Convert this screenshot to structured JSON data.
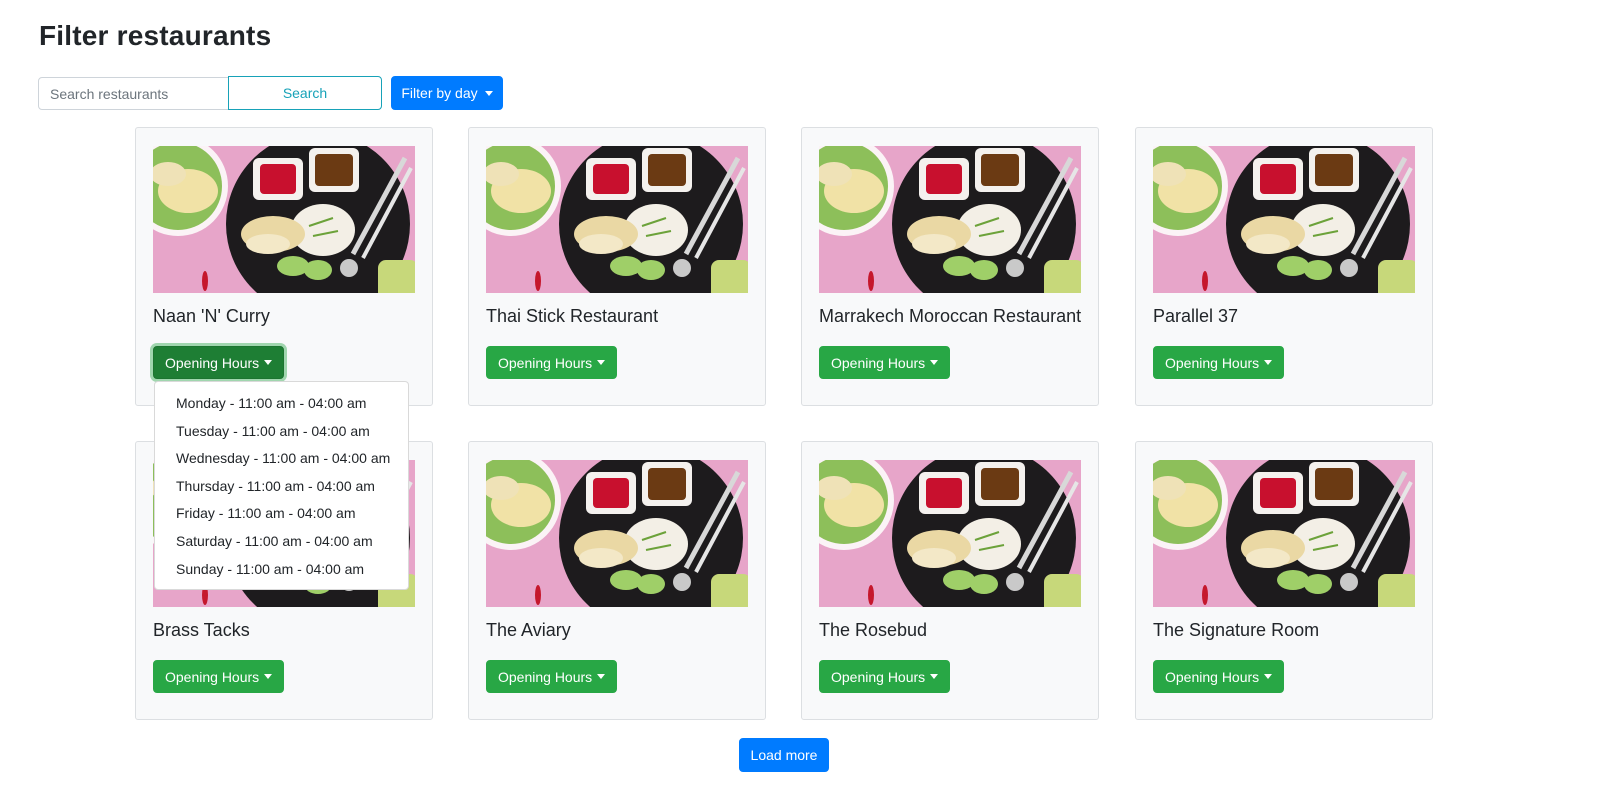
{
  "page": {
    "title": "Filter restaurants"
  },
  "search": {
    "placeholder": "Search restaurants",
    "value": "",
    "button_label": "Search"
  },
  "filter": {
    "button_label": "Filter by day"
  },
  "restaurants": [
    {
      "name": "Naan 'N' Curry",
      "hours_label": "Opening Hours"
    },
    {
      "name": "Thai Stick Restaurant",
      "hours_label": "Opening Hours"
    },
    {
      "name": "Marrakech Moroccan Restaurant",
      "hours_label": "Opening Hours"
    },
    {
      "name": "Parallel 37",
      "hours_label": "Opening Hours"
    },
    {
      "name": "Brass Tacks",
      "hours_label": "Opening Hours"
    },
    {
      "name": "The Aviary",
      "hours_label": "Opening Hours"
    },
    {
      "name": "The Rosebud",
      "hours_label": "Opening Hours"
    },
    {
      "name": "The Signature Room",
      "hours_label": "Opening Hours"
    }
  ],
  "open_dropdown": {
    "restaurant": "Naan 'N' Curry",
    "items": [
      "Monday - 11:00 am - 04:00 am",
      "Tuesday - 11:00 am - 04:00 am",
      "Wednesday - 11:00 am - 04:00 am",
      "Thursday - 11:00 am - 04:00 am",
      "Friday - 11:00 am - 04:00 am",
      "Saturday - 11:00 am - 04:00 am",
      "Sunday - 11:00 am - 04:00 am"
    ]
  },
  "footer": {
    "load_more_label": "Load more"
  },
  "colors": {
    "primary": "#007bff",
    "success": "#28a745",
    "info": "#17a2b8",
    "card_bg": "#f8f9fa"
  }
}
